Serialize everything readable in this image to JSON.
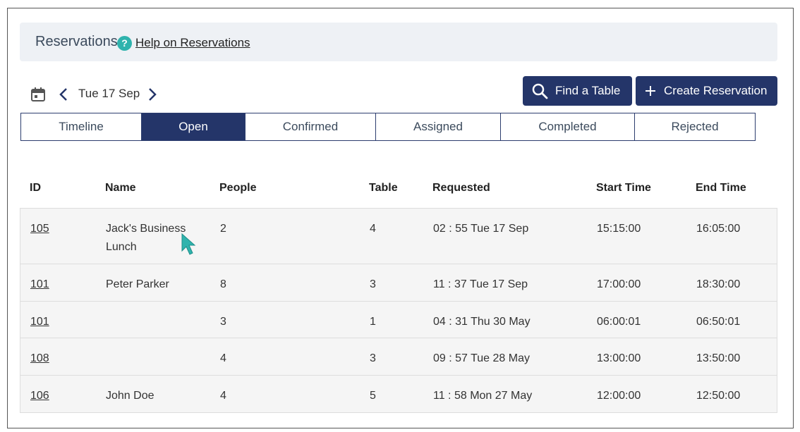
{
  "header": {
    "title": "Reservations",
    "help_icon_glyph": "?",
    "help_link": "Help on Reservations"
  },
  "date_nav": {
    "date": "Tue 17 Sep",
    "calendar_icon": "calendar-icon",
    "prev_icon": "chevron-left-icon",
    "next_icon": "chevron-right-icon"
  },
  "actions": {
    "find_label": "Find a Table",
    "create_label": "Create Reservation"
  },
  "tabs": [
    {
      "label": "Timeline"
    },
    {
      "label": "Open",
      "active": true
    },
    {
      "label": "Confirmed"
    },
    {
      "label": "Assigned"
    },
    {
      "label": "Completed"
    },
    {
      "label": "Rejected"
    }
  ],
  "table": {
    "columns": [
      "ID",
      "Name",
      "People",
      "Table",
      "Requested",
      "Start Time",
      "End Time"
    ],
    "rows": [
      {
        "id": "105",
        "name": "Jack's Business Lunch",
        "people": "2",
        "table": "4",
        "requested": "02 : 55 Tue 17 Sep",
        "start": "15:15:00",
        "end": "16:05:00"
      },
      {
        "id": "101",
        "name": "Peter Parker",
        "people": "8",
        "table": "3",
        "requested": "11 : 37 Tue 17 Sep",
        "start": "17:00:00",
        "end": "18:30:00"
      },
      {
        "id": "101",
        "name": "",
        "people": "3",
        "table": "1",
        "requested": "04 : 31 Thu 30 May",
        "start": "06:00:01",
        "end": "06:50:01"
      },
      {
        "id": "108",
        "name": "",
        "people": "4",
        "table": "3",
        "requested": "09 : 57 Tue 28 May",
        "start": "13:00:00",
        "end": "13:50:00"
      },
      {
        "id": "106",
        "name": "John Doe",
        "people": "4",
        "table": "5",
        "requested": "11 : 58 Mon 27 May",
        "start": "12:00:00",
        "end": "12:50:00"
      }
    ]
  },
  "colors": {
    "primary": "#243569",
    "help_icon": "#2fb3ad",
    "header_bg": "#eef1f5",
    "row_bg": "#f5f5f5"
  }
}
